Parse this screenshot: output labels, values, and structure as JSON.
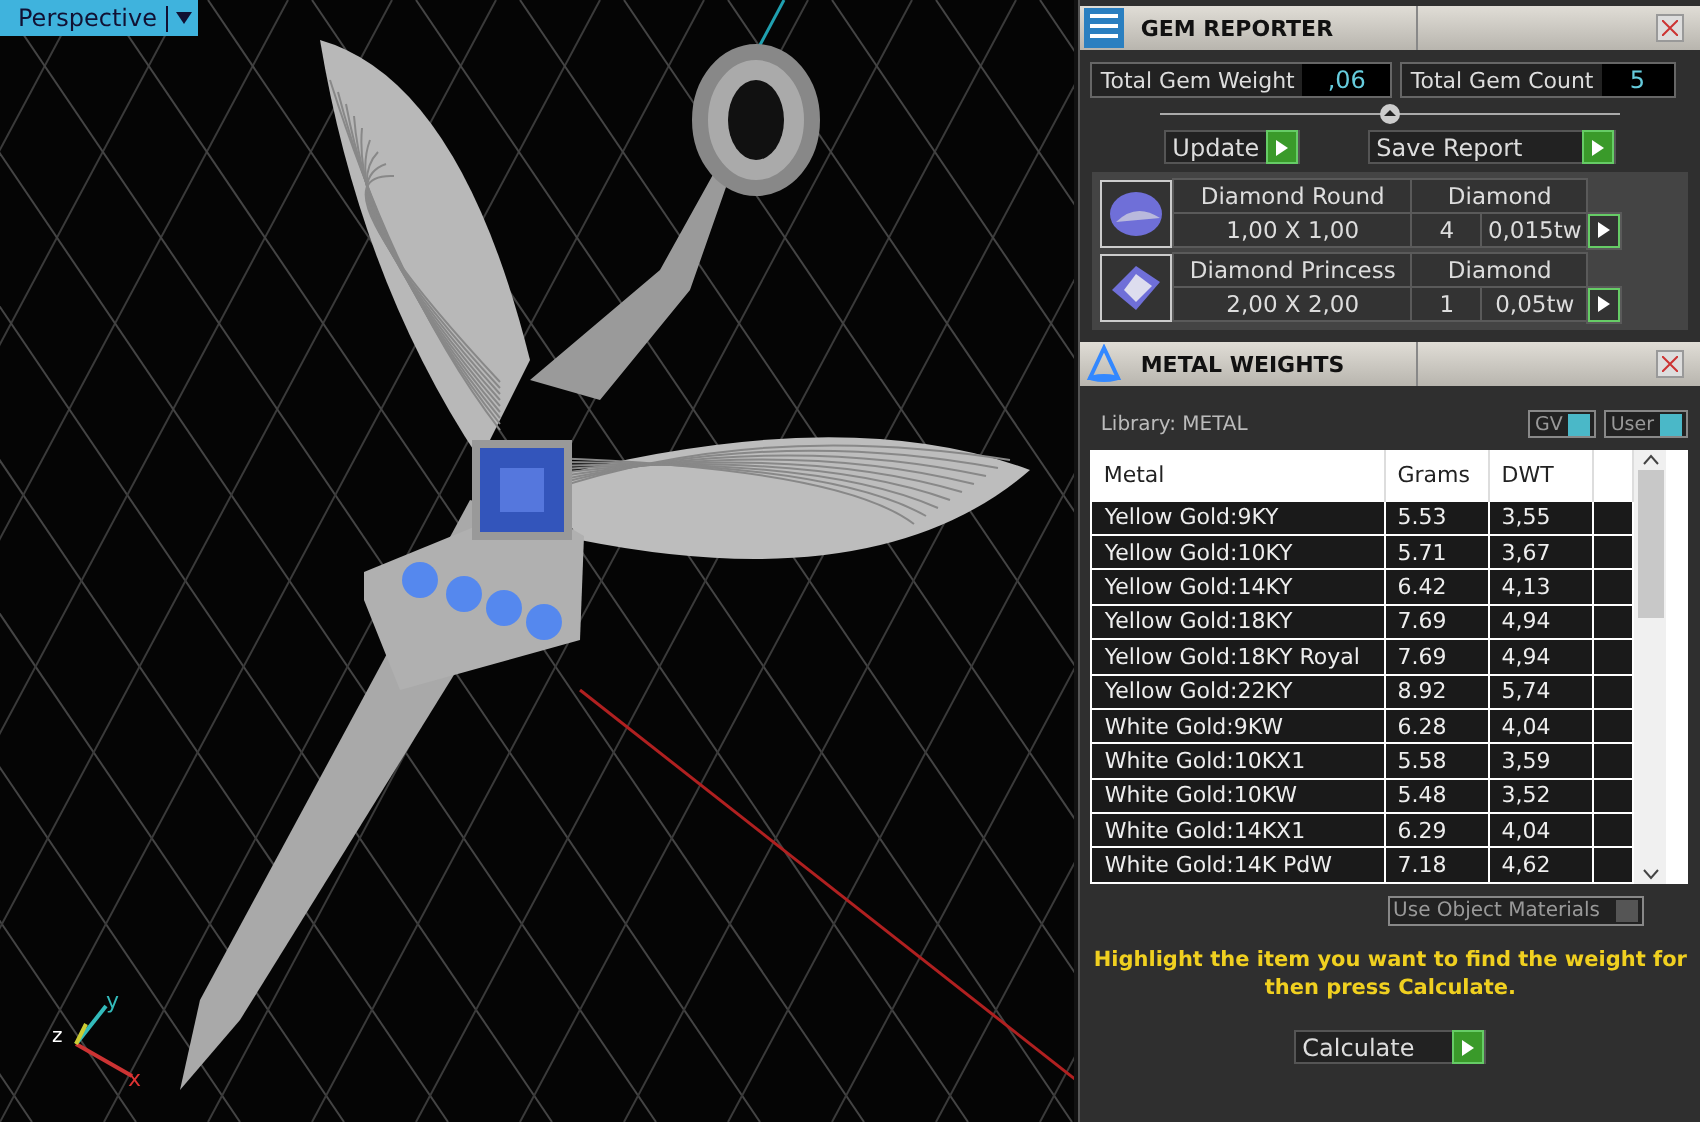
{
  "viewport": {
    "view_menu": "Perspective",
    "axis_labels": {
      "x": "x",
      "y": "y",
      "z": "z"
    }
  },
  "gem_reporter": {
    "title": "GEM REPORTER",
    "total_weight_label": "Total Gem Weight",
    "total_weight": ",06",
    "total_count_label": "Total Gem Count",
    "total_count": "5",
    "update": "Update",
    "save": "Save Report",
    "gems": [
      {
        "kind": "round",
        "name": "Diamond Round",
        "material": "Diamond",
        "size": "1,00 X 1,00",
        "count": "4",
        "weight": "0,015tw"
      },
      {
        "kind": "princess",
        "name": "Diamond Princess",
        "material": "Diamond",
        "size": "2,00 X 2,00",
        "count": "1",
        "weight": "0,05tw"
      }
    ]
  },
  "metal_weights": {
    "title": "METAL WEIGHTS",
    "library": "Library: METAL",
    "toggles": [
      {
        "label": "GV",
        "on": true
      },
      {
        "label": "User",
        "on": true
      }
    ],
    "columns": [
      "Metal",
      "Grams",
      "DWT"
    ],
    "rows": [
      [
        "Yellow Gold:9KY",
        "5.53",
        "3,55"
      ],
      [
        "Yellow Gold:10KY",
        "5.71",
        "3,67"
      ],
      [
        "Yellow Gold:14KY",
        "6.42",
        "4,13"
      ],
      [
        "Yellow Gold:18KY",
        "7.69",
        "4,94"
      ],
      [
        "Yellow Gold:18KY Royal",
        "7.69",
        "4,94"
      ],
      [
        "Yellow Gold:22KY",
        "8.92",
        "5,74"
      ],
      [
        "White Gold:9KW",
        "6.28",
        "4,04"
      ],
      [
        "White Gold:10KX1",
        "5.58",
        "3,59"
      ],
      [
        "White Gold:10KW",
        "5.48",
        "3,52"
      ],
      [
        "White Gold:14KX1",
        "6.29",
        "4,04"
      ],
      [
        "White Gold:14K PdW",
        "7.18",
        "4,62"
      ]
    ],
    "use_object_materials": {
      "label": "Use Object Materials",
      "on": false
    },
    "message": "Highlight the item you want to find the weight for then press Calculate.",
    "calculate": "Calculate"
  }
}
